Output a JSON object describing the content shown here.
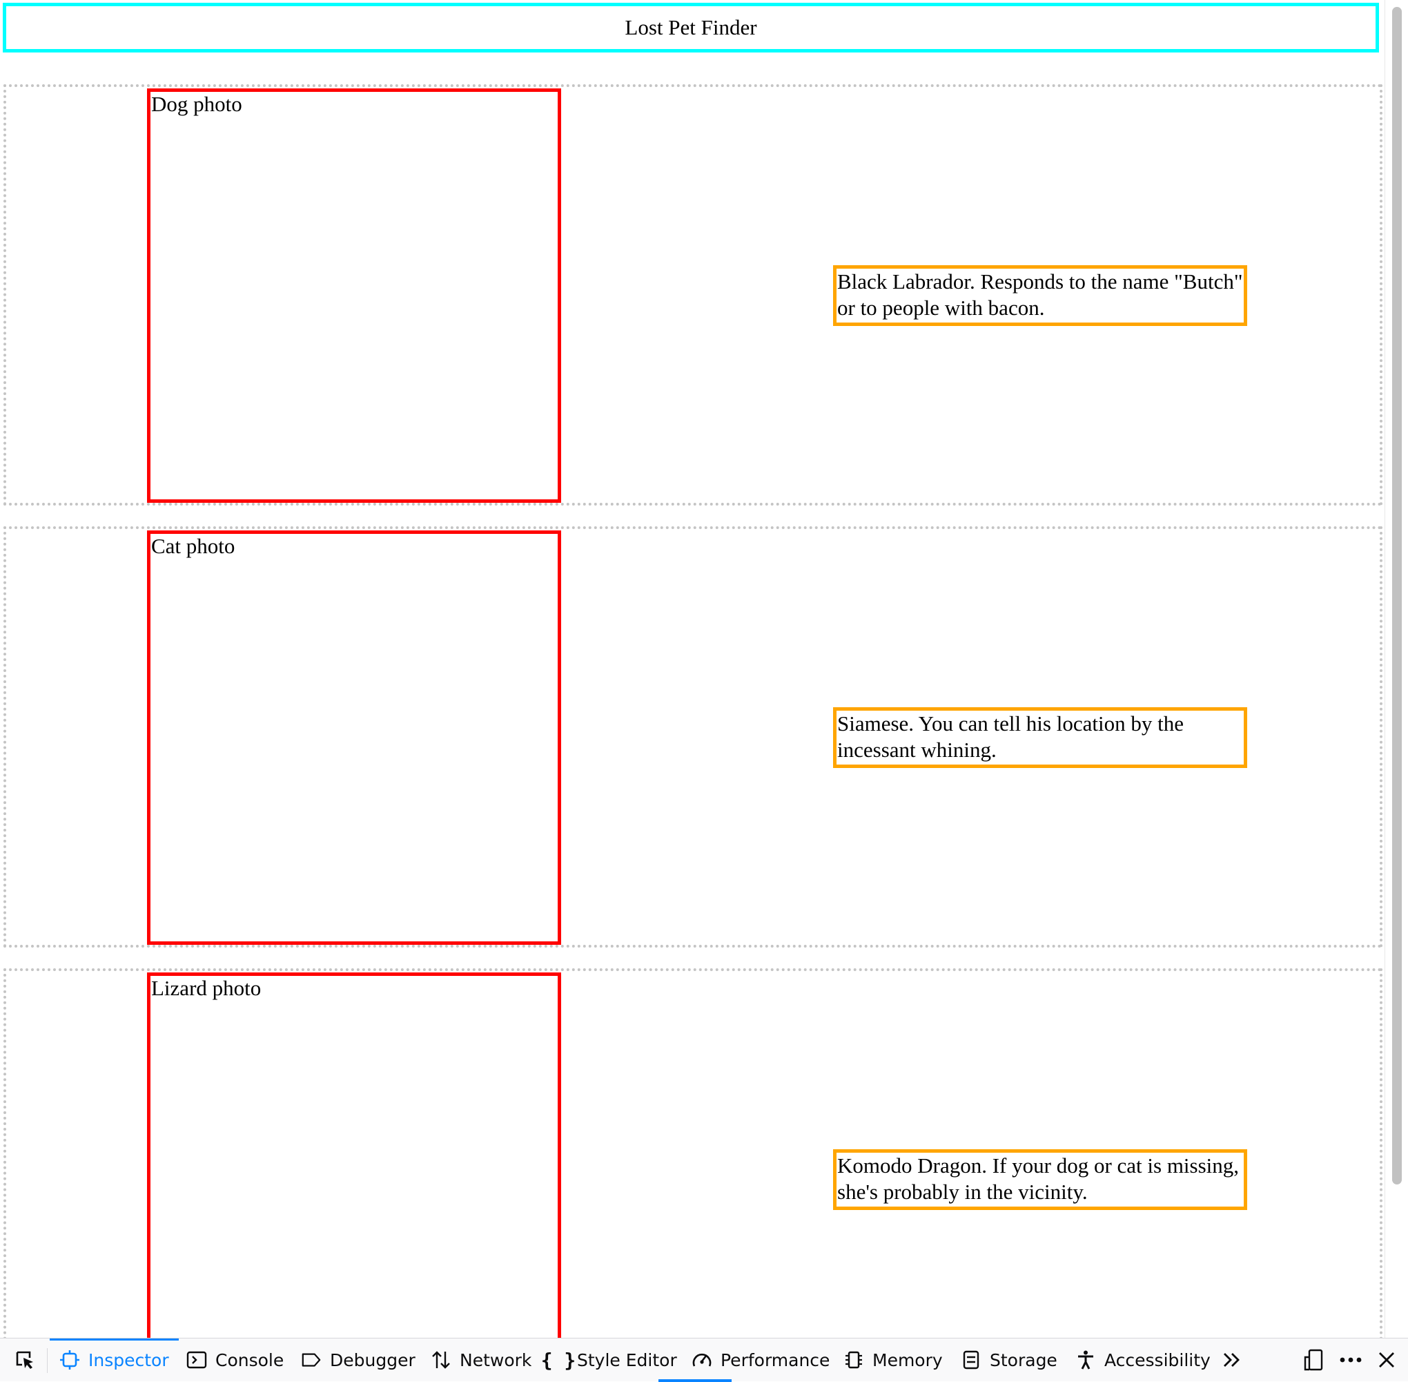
{
  "page": {
    "title": "Lost Pet Finder"
  },
  "pets": [
    {
      "photo_label": "Dog photo",
      "description": "Black Labrador. Responds to the name \"Butch\" or to people with bacon."
    },
    {
      "photo_label": "Cat photo",
      "description": "Siamese. You can tell his location by the incessant whining."
    },
    {
      "photo_label": "Lizard photo",
      "description": "Komodo Dragon. If your dog or cat is missing, she's probably in the vicinity."
    }
  ],
  "devtools": {
    "tabs": [
      {
        "label": "Inspector",
        "icon": "inspector-icon",
        "active": true
      },
      {
        "label": "Console",
        "icon": "console-icon",
        "active": false
      },
      {
        "label": "Debugger",
        "icon": "debugger-icon",
        "active": false
      },
      {
        "label": "Network",
        "icon": "network-icon",
        "active": false
      },
      {
        "label": "Style Editor",
        "icon": "style-editor-icon",
        "active": false
      },
      {
        "label": "Performance",
        "icon": "performance-icon",
        "active": false
      },
      {
        "label": "Memory",
        "icon": "memory-icon",
        "active": false
      },
      {
        "label": "Storage",
        "icon": "storage-icon",
        "active": false
      },
      {
        "label": "Accessibility",
        "icon": "accessibility-icon",
        "active": false
      }
    ],
    "accent_color": "#0a84ff"
  },
  "colors": {
    "header_border": "#00ffff",
    "photo_border": "#ff0000",
    "description_border": "#ffa500",
    "row_border": "#c4c4c4"
  }
}
